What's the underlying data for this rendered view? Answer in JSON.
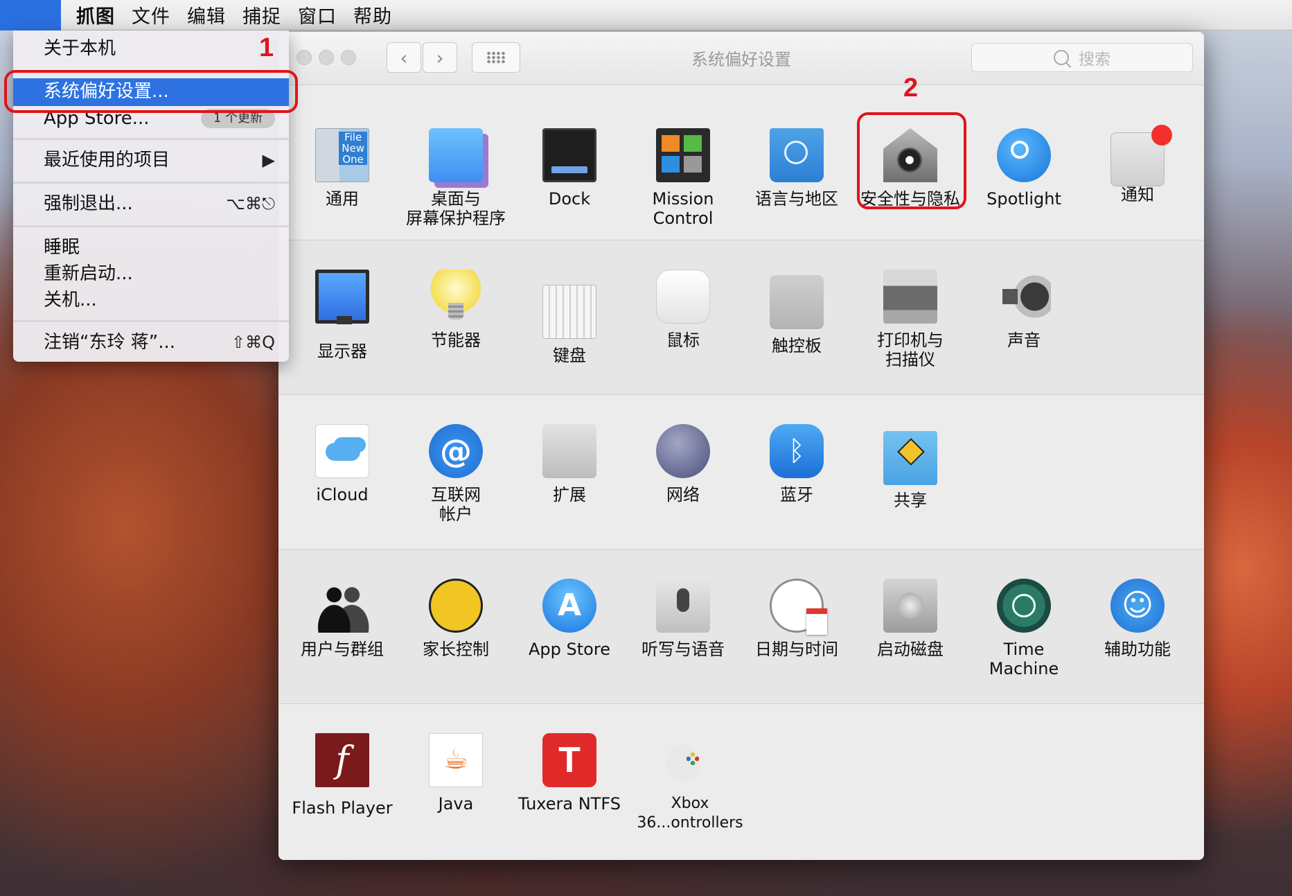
{
  "menubar": {
    "apple_icon": "apple-logo-icon",
    "items": [
      "抓图",
      "文件",
      "编辑",
      "捕捉",
      "窗口",
      "帮助"
    ]
  },
  "window": {
    "title": "系统偏好设置",
    "search_placeholder": "搜索",
    "nav_back": "‹",
    "nav_forward": "›"
  },
  "sections": [
    {
      "panes": [
        {
          "label": "通用",
          "icon": "general-icon",
          "badge_text": "File\nNew\nOne"
        },
        {
          "label": "桌面与\n屏幕保护程序",
          "icon": "desktop-screensaver-icon"
        },
        {
          "label": "Dock",
          "icon": "dock-icon"
        },
        {
          "label": "Mission\nControl",
          "icon": "mission-control-icon"
        },
        {
          "label": "语言与地区",
          "icon": "language-region-icon"
        },
        {
          "label": "安全性与隐私",
          "icon": "security-privacy-icon"
        },
        {
          "label": "Spotlight",
          "icon": "spotlight-icon"
        },
        {
          "label": "通知",
          "icon": "notifications-icon"
        }
      ]
    },
    {
      "panes": [
        {
          "label": "显示器",
          "icon": "displays-icon"
        },
        {
          "label": "节能器",
          "icon": "energy-saver-icon"
        },
        {
          "label": "键盘",
          "icon": "keyboard-icon"
        },
        {
          "label": "鼠标",
          "icon": "mouse-icon"
        },
        {
          "label": "触控板",
          "icon": "trackpad-icon"
        },
        {
          "label": "打印机与\n扫描仪",
          "icon": "printer-scanner-icon"
        },
        {
          "label": "声音",
          "icon": "sound-icon"
        }
      ]
    },
    {
      "panes": [
        {
          "label": "iCloud",
          "icon": "icloud-icon"
        },
        {
          "label": "互联网\n帐户",
          "icon": "internet-accounts-icon"
        },
        {
          "label": "扩展",
          "icon": "extensions-icon"
        },
        {
          "label": "网络",
          "icon": "network-icon"
        },
        {
          "label": "蓝牙",
          "icon": "bluetooth-icon"
        },
        {
          "label": "共享",
          "icon": "sharing-icon"
        }
      ]
    },
    {
      "panes": [
        {
          "label": "用户与群组",
          "icon": "users-groups-icon"
        },
        {
          "label": "家长控制",
          "icon": "parental-controls-icon"
        },
        {
          "label": "App Store",
          "icon": "app-store-icon"
        },
        {
          "label": "听写与语音",
          "icon": "dictation-speech-icon"
        },
        {
          "label": "日期与时间",
          "icon": "date-time-icon"
        },
        {
          "label": "启动磁盘",
          "icon": "startup-disk-icon"
        },
        {
          "label": "Time Machine",
          "icon": "time-machine-icon"
        },
        {
          "label": "辅助功能",
          "icon": "accessibility-icon"
        }
      ]
    },
    {
      "panes": [
        {
          "label": "Flash Player",
          "icon": "flash-player-icon"
        },
        {
          "label": "Java",
          "icon": "java-icon"
        },
        {
          "label": "Tuxera NTFS",
          "icon": "tuxera-ntfs-icon"
        },
        {
          "label": "Xbox 36...ontrollers",
          "icon": "xbox-controllers-icon"
        }
      ]
    }
  ],
  "apple_menu": {
    "about": "关于本机",
    "system_prefs": "系统偏好设置...",
    "app_store": "App Store...",
    "app_store_badge": "1 个更新",
    "recent_items": "最近使用的项目",
    "recent_arrow": "▶",
    "force_quit": "强制退出...",
    "force_quit_shortcut": "⌥⌘⎋",
    "sleep": "睡眠",
    "restart": "重新启动...",
    "shutdown": "关机...",
    "logout": "注销“东玲 蒋”...",
    "logout_shortcut": "⇧⌘Q"
  },
  "annotations": {
    "mark1": "1",
    "mark2": "2",
    "color": "#e0141b"
  },
  "colors": {
    "menu_highlight": "#2d72e0",
    "notification_badge": "#f1302b"
  }
}
